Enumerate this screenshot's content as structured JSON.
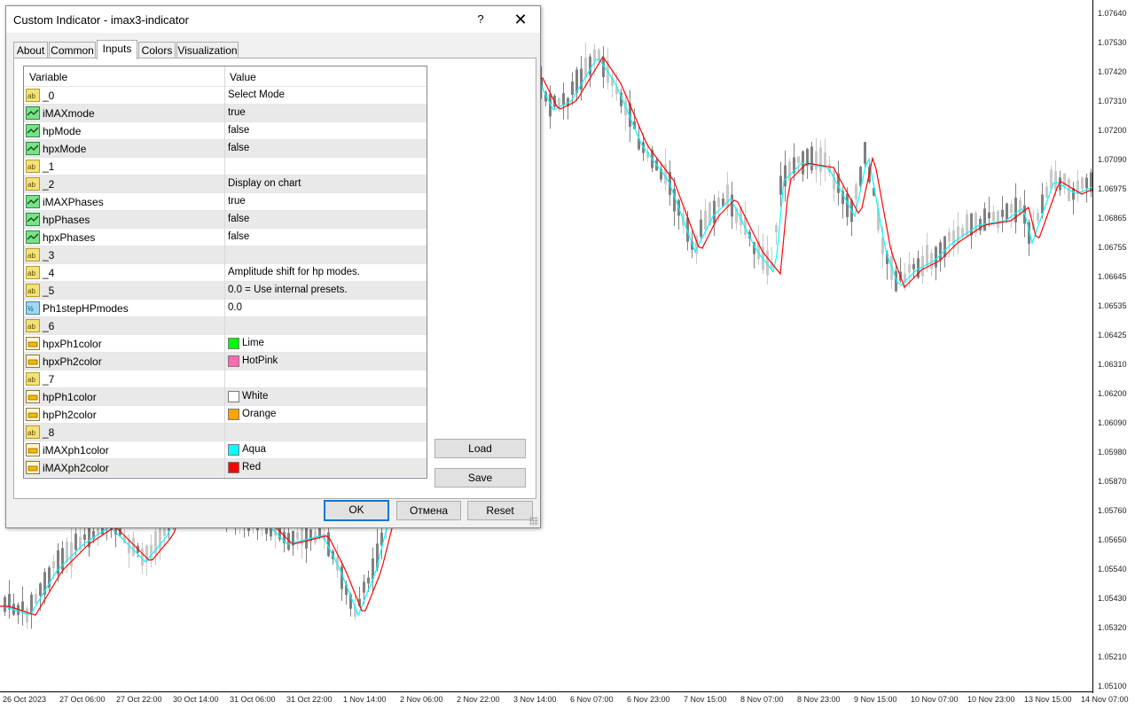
{
  "dialog": {
    "title": "Custom Indicator - imax3-indicator",
    "help_label": "?",
    "close_label": "✕",
    "tabs": [
      {
        "label": "About"
      },
      {
        "label": "Common"
      },
      {
        "label": "Inputs",
        "active": true
      },
      {
        "label": "Colors"
      },
      {
        "label": "Visualization"
      }
    ],
    "grid": {
      "columns": [
        "Variable",
        "Value"
      ],
      "rows": [
        {
          "icon": "ab-string-icon",
          "name": "_0",
          "value": "Select Mode"
        },
        {
          "icon": "bool-chart-icon",
          "name": "iMAXmode",
          "value": "true"
        },
        {
          "icon": "bool-chart-icon",
          "name": "hpMode",
          "value": "false"
        },
        {
          "icon": "bool-chart-icon",
          "name": "hpxMode",
          "value": "false"
        },
        {
          "icon": "ab-string-icon",
          "name": "_1",
          "value": ""
        },
        {
          "icon": "ab-string-icon",
          "name": "_2",
          "value": "Display on chart"
        },
        {
          "icon": "bool-chart-icon",
          "name": "iMAXPhases",
          "value": "true"
        },
        {
          "icon": "bool-chart-icon",
          "name": "hpPhases",
          "value": "false"
        },
        {
          "icon": "bool-chart-icon",
          "name": "hpxPhases",
          "value": "false"
        },
        {
          "icon": "ab-string-icon",
          "name": "_3",
          "value": ""
        },
        {
          "icon": "ab-string-icon",
          "name": "_4",
          "value": "Amplitude shift for hp modes."
        },
        {
          "icon": "ab-string-icon",
          "name": "_5",
          "value": "0.0 = Use internal presets."
        },
        {
          "icon": "double-value-icon",
          "name": "Ph1stepHPmodes",
          "value": "0.0"
        },
        {
          "icon": "ab-string-icon",
          "name": "_6",
          "value": ""
        },
        {
          "icon": "color-param-icon",
          "name": "hpxPh1color",
          "value": "Lime",
          "swatch": "#00ff00"
        },
        {
          "icon": "color-param-icon",
          "name": "hpxPh2color",
          "value": "HotPink",
          "swatch": "#ff69b4"
        },
        {
          "icon": "ab-string-icon",
          "name": "_7",
          "value": ""
        },
        {
          "icon": "color-param-icon",
          "name": "hpPh1color",
          "value": "White",
          "swatch": "#ffffff"
        },
        {
          "icon": "color-param-icon",
          "name": "hpPh2color",
          "value": "Orange",
          "swatch": "#ffa500"
        },
        {
          "icon": "ab-string-icon",
          "name": "_8",
          "value": ""
        },
        {
          "icon": "color-param-icon",
          "name": "iMAXph1color",
          "value": "Aqua",
          "swatch": "#00ffff"
        },
        {
          "icon": "color-param-icon",
          "name": "iMAXph2color",
          "value": "Red",
          "swatch": "#ff0000"
        }
      ]
    },
    "buttons": {
      "load": "Load",
      "save": "Save",
      "ok": "OK",
      "cancel": "Отмена",
      "reset": "Reset"
    }
  },
  "chart": {
    "price_labels": [
      "1.07640",
      "1.07530",
      "1.07420",
      "1.07310",
      "1.07200",
      "1.07090",
      "1.06975",
      "1.06865",
      "1.06755",
      "1.06645",
      "1.06535",
      "1.06425",
      "1.06310",
      "1.06200",
      "1.06090",
      "1.05980",
      "1.05870",
      "1.05760",
      "1.05650",
      "1.05540",
      "1.05430",
      "1.05320",
      "1.05210",
      "1.05100"
    ],
    "time_labels": [
      "26 Oct 2023",
      "27 Oct 06:00",
      "27 Oct 22:00",
      "30 Oct 14:00",
      "31 Oct 06:00",
      "31 Oct 22:00",
      "1 Nov 14:00",
      "2 Nov 06:00",
      "2 Nov 22:00",
      "3 Nov 14:00",
      "6 Nov 07:00",
      "6 Nov 23:00",
      "7 Nov 15:00",
      "8 Nov 07:00",
      "8 Nov 23:00",
      "9 Nov 15:00",
      "10 Nov 07:00",
      "10 Nov 23:00",
      "13 Nov 15:00",
      "14 Nov 07:00"
    ],
    "colors": {
      "ph1": "#00ffff",
      "ph2": "#ff0000",
      "candle_up": "#c8c8c8",
      "candle_down": "#808080"
    }
  }
}
